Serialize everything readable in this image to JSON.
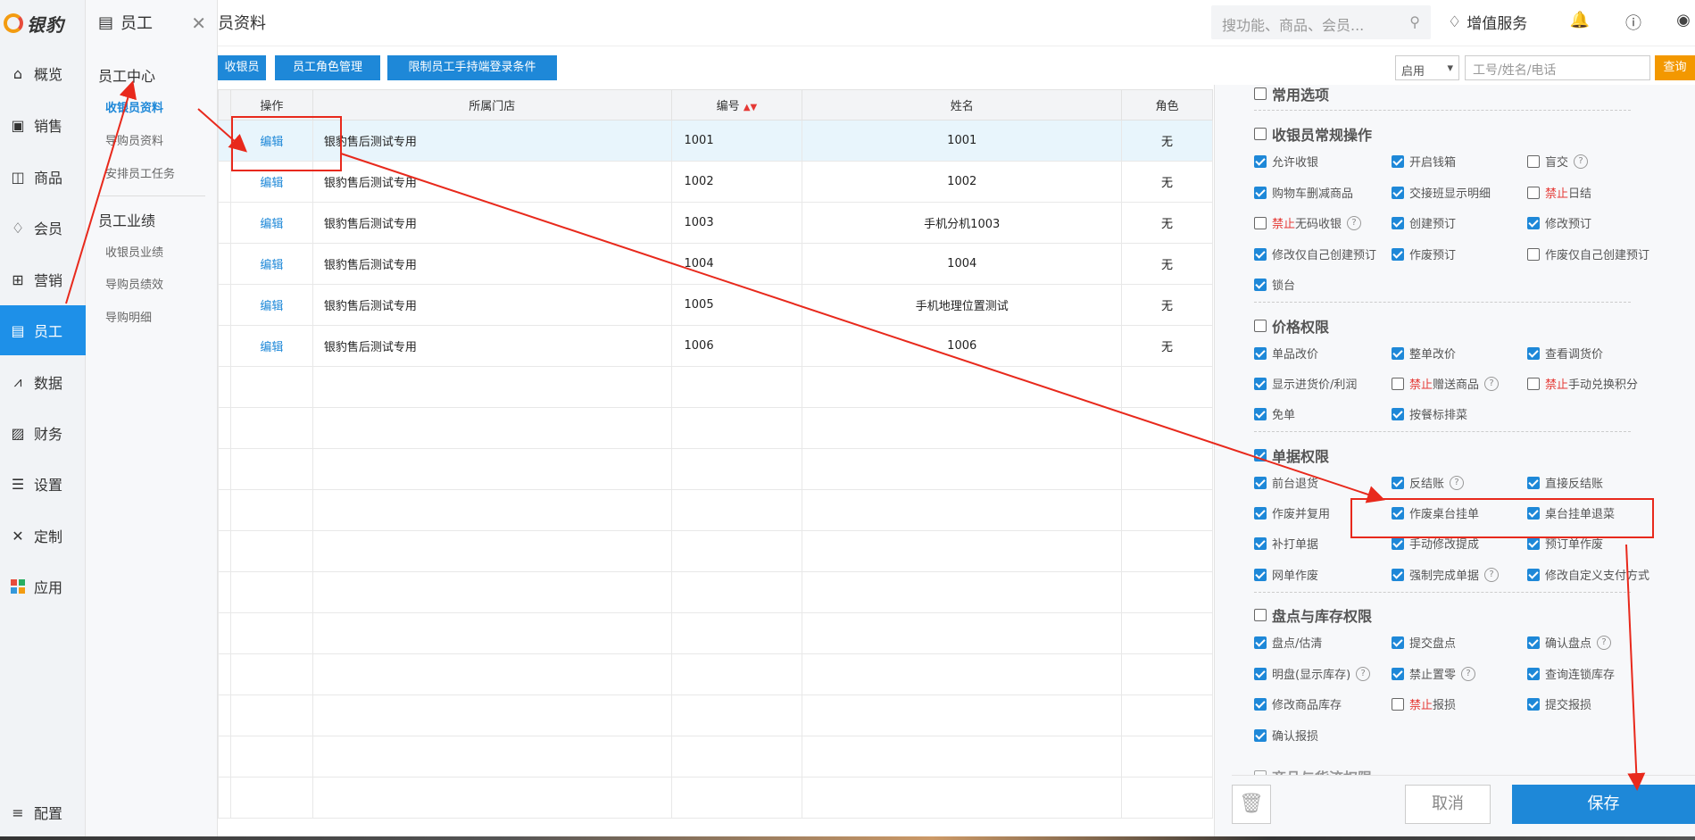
{
  "nav": {
    "logo": "银豹",
    "items": [
      {
        "label": "概览",
        "icon": "home-icon"
      },
      {
        "label": "销售",
        "icon": "cash-icon"
      },
      {
        "label": "商品",
        "icon": "box-icon"
      },
      {
        "label": "会员",
        "icon": "diamond-icon"
      },
      {
        "label": "营销",
        "icon": "gift-icon"
      },
      {
        "label": "员工",
        "icon": "id-card-icon",
        "active": true
      },
      {
        "label": "数据",
        "icon": "chart-icon"
      },
      {
        "label": "财务",
        "icon": "finance-icon"
      },
      {
        "label": "设置",
        "icon": "sliders-icon"
      },
      {
        "label": "定制",
        "icon": "tools-icon"
      },
      {
        "label": "应用",
        "icon": "apps-icon"
      }
    ],
    "config": "配置"
  },
  "sub": {
    "title": "员工",
    "group1": "员工中心",
    "links1": [
      "收银员资料",
      "导购员资料",
      "安排员工任务"
    ],
    "group2": "员工业绩",
    "links2": [
      "收银员业绩",
      "导购员绩效",
      "导购明细"
    ]
  },
  "top": {
    "title": "员资料",
    "search_placeholder": "搜功能、商品、会员...",
    "vas": "增值服务"
  },
  "toolbar": {
    "btn1": "收银员",
    "btn2": "员工角色管理",
    "btn3": "限制员工手持端登录条件",
    "status": "启用",
    "filter_placeholder": "工号/姓名/电话",
    "query": "查询"
  },
  "table": {
    "headers": [
      "操作",
      "所属门店",
      "编号",
      "姓名",
      "角色"
    ],
    "rows": [
      {
        "op": "编辑",
        "store": "银豹售后测试专用",
        "num": "1001",
        "name": "1001",
        "role": "无"
      },
      {
        "op": "编辑",
        "store": "银豹售后测试专用",
        "num": "1002",
        "name": "1002",
        "role": "无"
      },
      {
        "op": "编辑",
        "store": "银豹售后测试专用",
        "num": "1003",
        "name": "手机分机1003",
        "role": "无"
      },
      {
        "op": "编辑",
        "store": "银豹售后测试专用",
        "num": "1004",
        "name": "1004",
        "role": "无"
      },
      {
        "op": "编辑",
        "store": "银豹售后测试专用",
        "num": "1005",
        "name": "手机地理位置测试",
        "role": "无"
      },
      {
        "op": "编辑",
        "store": "银豹售后测试专用",
        "num": "1006",
        "name": "1006",
        "role": "无"
      }
    ]
  },
  "panel": {
    "s0": "常用选项",
    "s1": "收银员常规操作",
    "s2": "价格权限",
    "s3": "单据权限",
    "s4": "盘点与库存权限",
    "s5": "商品与货流权限",
    "forbid": "禁止",
    "p": {
      "a1": "允许收银",
      "a2": "开启钱箱",
      "a3": "盲交",
      "a4": "购物车删减商品",
      "a5": "交接班显示明细",
      "a6": "日结",
      "a7": "无码收银",
      "a8": "创建预订",
      "a9": "修改预订",
      "a10": "修改仅自己创建预订",
      "a11": "作废预订",
      "a12": "作废仅自己创建预订",
      "a13": "锁台",
      "b1": "单品改价",
      "b2": "整单改价",
      "b3": "查看调货价",
      "b4": "显示进货价/利润",
      "b5": "赠送商品",
      "b6": "手动兑换积分",
      "b7": "免单",
      "b8": "按餐标排菜",
      "c1": "前台退货",
      "c2": "反结账",
      "c3": "直接反结账",
      "c4": "作废并复用",
      "c5": "作废桌台挂单",
      "c6": "桌台挂单退菜",
      "c7": "补打单据",
      "c8": "手动修改提成",
      "c9": "预订单作废",
      "c10": "网单作废",
      "c11": "强制完成单据",
      "c12": "修改自定义支付方式",
      "d1": "盘点/估清",
      "d2": "提交盘点",
      "d3": "确认盘点",
      "d4": "明盘(显示库存)",
      "d5": "禁止置零",
      "d6": "查询连锁库存",
      "d7": "修改商品库存",
      "d8": "报损",
      "d9": "提交报损",
      "d10": "确认报损"
    }
  },
  "footer": {
    "cancel": "取消",
    "save": "保存"
  },
  "colors": {
    "accent": "#1e88d8",
    "annotation": "#e8291c",
    "query": "#f39800"
  }
}
